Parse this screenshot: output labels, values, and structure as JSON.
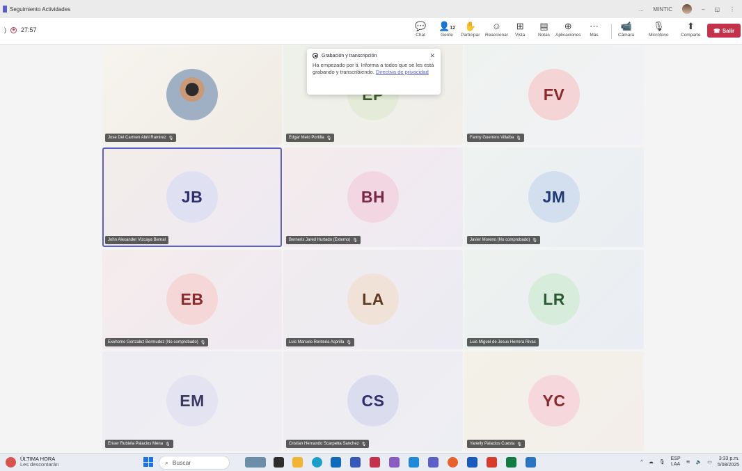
{
  "window": {
    "title": "Seguimiento Actividades",
    "org": "MINTIC",
    "controls": {
      "more": "...",
      "minimize": "–",
      "restore": "◱",
      "close": "⋮"
    }
  },
  "meeting": {
    "elapsed": "27:57"
  },
  "toolbar": {
    "chat": "Chat",
    "people": "Gente",
    "people_count": "12",
    "raise_hand": "Participar",
    "react": "Reaccionar",
    "view": "Vista",
    "notes": "Notas",
    "apps": "Aplicaciones",
    "more": "Más",
    "camera": "Cámara",
    "mic": "Micrófono",
    "share": "Comparte",
    "leave": "Salir"
  },
  "recording_popup": {
    "title": "Grabación y transcripción",
    "message": "Ha empezado por ti. Informa a todos que se les está grabando y transcribiendo.",
    "link": "Directiva de privacidad"
  },
  "participants": [
    {
      "name": "Jose Del Carmen Abril Ramirez",
      "initials": "",
      "avatar_color": "#8fa6c2",
      "text_color": "#1f3b73",
      "has_photo": true,
      "muted": true
    },
    {
      "name": "Edgar Melo Portilla",
      "initials": "EP",
      "avatar_color": "#e4ecd9",
      "text_color": "#3d5a2a",
      "has_photo": false,
      "muted": true
    },
    {
      "name": "Fanny Guerrero Villalba",
      "initials": "FV",
      "avatar_color": "#f4d4d4",
      "text_color": "#8a2a2a",
      "has_photo": false,
      "muted": true
    },
    {
      "name": "John Alexander Vizcaya Bernal",
      "initials": "JB",
      "avatar_color": "#dfe1f3",
      "text_color": "#2e2e6e",
      "has_photo": false,
      "muted": false
    },
    {
      "name": "Berneris Jared Hurtado (Externo)",
      "initials": "BH",
      "avatar_color": "#f2d6e2",
      "text_color": "#7a2448",
      "has_photo": false,
      "muted": true
    },
    {
      "name": "Javier Moreno (No comprobado)",
      "initials": "JM",
      "avatar_color": "#d3deef",
      "text_color": "#1f3b73",
      "has_photo": false,
      "muted": true
    },
    {
      "name": "Exehomo Gonzalez Bermudez (No comprobado)",
      "initials": "EB",
      "avatar_color": "#f6d7d7",
      "text_color": "#8a2a2a",
      "has_photo": false,
      "muted": true
    },
    {
      "name": "Luis Marcelo Renteria Asprilla",
      "initials": "LA",
      "avatar_color": "#f1e2d8",
      "text_color": "#5e3a22",
      "has_photo": false,
      "muted": true
    },
    {
      "name": "Luis Miguel de Jesus Herrera Rivas",
      "initials": "LR",
      "avatar_color": "#d8ecdb",
      "text_color": "#2a5a32",
      "has_photo": false,
      "muted": false
    },
    {
      "name": "Enuer Rubiela Palacios Mena",
      "initials": "EM",
      "avatar_color": "#e4e3f2",
      "text_color": "#3a3a60",
      "has_photo": false,
      "muted": true
    },
    {
      "name": "Cristian Hernando Scarpetta Sanchez",
      "initials": "CS",
      "avatar_color": "#dcdcef",
      "text_color": "#2e2e6e",
      "has_photo": false,
      "muted": true
    },
    {
      "name": "Yanelly Palacios Cuesta",
      "initials": "YC",
      "avatar_color": "#f6d8dc",
      "text_color": "#8a2a2a",
      "has_photo": false,
      "muted": true
    }
  ],
  "taskbar": {
    "news_title": "ÚLTIMA HORA",
    "news_sub": "Les descontarán",
    "search_placeholder": "Buscar",
    "lang_1": "ESP",
    "lang_2": "LAA",
    "time": "3:33 p.m.",
    "date": "5/08/2025"
  }
}
